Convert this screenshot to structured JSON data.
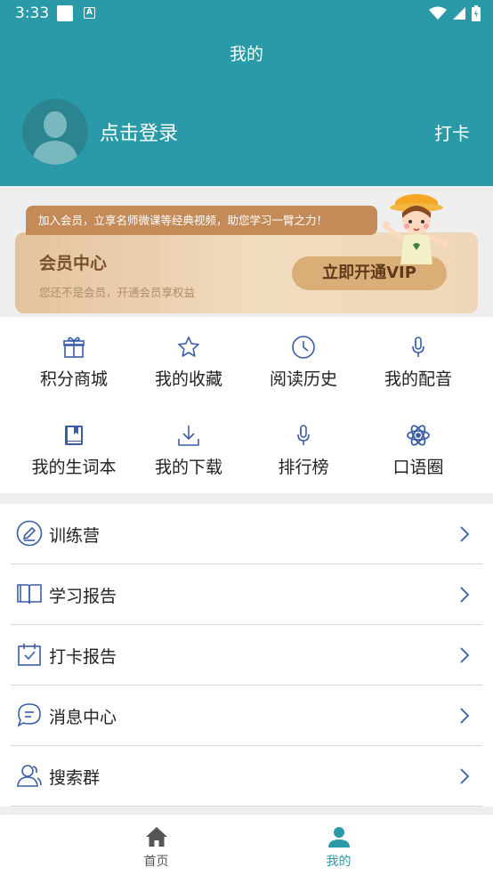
{
  "status": {
    "time": "3:33",
    "badge": "A"
  },
  "header": {
    "title": "我的",
    "login_text": "点击登录",
    "checkin": "打卡"
  },
  "vip": {
    "ribbon": "加入会员，立享名师微课等经典视频，助您学习一臂之力！",
    "title": "会员中心",
    "subtitle": "您还不是会员，开通会员享权益",
    "button": "立即开通VIP"
  },
  "grid": [
    {
      "label": "积分商城",
      "icon": "gift-icon"
    },
    {
      "label": "我的收藏",
      "icon": "star-icon"
    },
    {
      "label": "阅读历史",
      "icon": "clock-icon"
    },
    {
      "label": "我的配音",
      "icon": "microphone-icon"
    },
    {
      "label": "我的生词本",
      "icon": "notebook-icon"
    },
    {
      "label": "我的下载",
      "icon": "download-icon"
    },
    {
      "label": "排行榜",
      "icon": "microphone-icon"
    },
    {
      "label": "口语圈",
      "icon": "atom-icon"
    }
  ],
  "list": [
    {
      "label": "训练营",
      "icon": "pencil-circle-icon"
    },
    {
      "label": "学习报告",
      "icon": "open-book-icon"
    },
    {
      "label": "打卡报告",
      "icon": "calendar-check-icon"
    },
    {
      "label": "消息中心",
      "icon": "chat-bubble-icon"
    },
    {
      "label": "搜索群",
      "icon": "group-icon"
    }
  ],
  "tabs": [
    {
      "label": "首页",
      "icon": "home-icon",
      "active": false
    },
    {
      "label": "我的",
      "icon": "person-icon",
      "active": true
    }
  ],
  "colors": {
    "primary": "#2b9aa8",
    "icon_blue": "#3b5da8",
    "tab_inactive": "#555555",
    "vip_brown": "#7a4f2c"
  }
}
